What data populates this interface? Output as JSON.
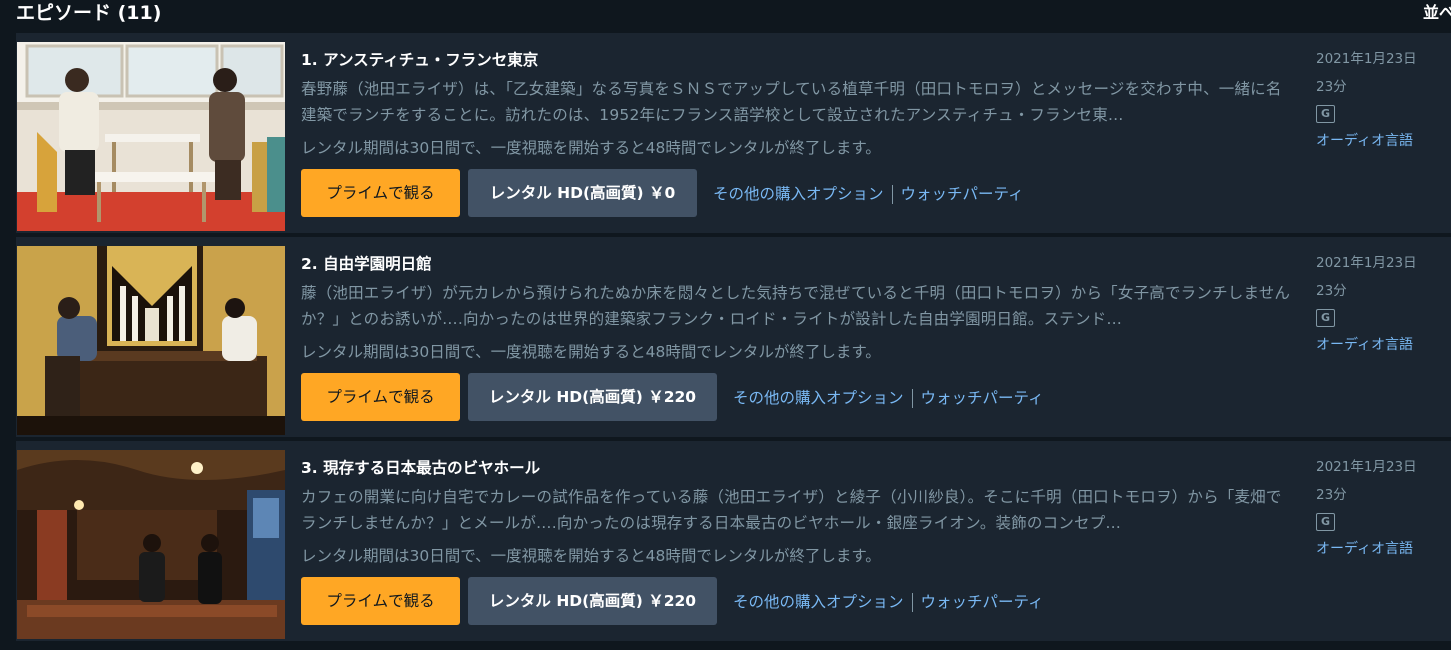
{
  "header": {
    "title": "エピソード (11)",
    "sort_label": "並べ替え"
  },
  "episodes": [
    {
      "title": "1. アンスティチュ・フランセ東京",
      "synopsis": "春野藤（池田エライザ）は、「乙女建築」なる写真をＳＮＳでアップしている植草千明（田口トモロヲ）とメッセージを交わす中、一緒に名建築でランチをすることに。訪れたのは、1952年にフランス語学校として設立されたアンスティチュ・フランセ東…",
      "rental_note": "レンタル期間は30日間で、一度視聴を開始すると48時間でレンタルが終了します。",
      "prime_button": "プライムで観る",
      "rent_button": "レンタル HD(高画質) ￥0",
      "other_options": "その他の購入オプション",
      "watch_party": "ウォッチパーティ",
      "date": "2021年1月23日",
      "runtime": "23分",
      "rating": "G",
      "audio": "オーディオ言語",
      "thumbnail_icon": "cafe-scene-thumbnail"
    },
    {
      "title": "2. 自由学園明日館",
      "synopsis": "藤（池田エライザ）が元カレから預けられたぬか床を悶々とした気持ちで混ぜていると千明（田口トモロヲ）から「女子高でランチしませんか？」とのお誘いが….向かったのは世界的建築家フランク・ロイド・ライトが設計した自由学園明日館。ステンド…",
      "rental_note": "レンタル期間は30日間で、一度視聴を開始すると48時間でレンタルが終了します。",
      "prime_button": "プライムで観る",
      "rent_button": "レンタル HD(高画質) ￥220",
      "other_options": "その他の購入オプション",
      "watch_party": "ウォッチパーティ",
      "date": "2021年1月23日",
      "runtime": "23分",
      "rating": "G",
      "audio": "オーディオ言語",
      "thumbnail_icon": "dining-hall-thumbnail"
    },
    {
      "title": "3. 現存する日本最古のビヤホール",
      "synopsis": "カフェの開業に向け自宅でカレーの試作品を作っている藤（池田エライザ）と綾子（小川紗良）。そこに千明（田口トモロヲ）から「麦畑でランチしませんか？」とメールが….向かったのは現存する日本最古のビヤホール・銀座ライオン。装飾のコンセプ…",
      "rental_note": "レンタル期間は30日間で、一度視聴を開始すると48時間でレンタルが終了します。",
      "prime_button": "プライムで観る",
      "rent_button": "レンタル HD(高画質) ￥220",
      "other_options": "その他の購入オプション",
      "watch_party": "ウォッチパーティ",
      "date": "2021年1月23日",
      "runtime": "23分",
      "rating": "G",
      "audio": "オーディオ言語",
      "thumbnail_icon": "beer-hall-thumbnail"
    }
  ],
  "colors": {
    "background": "#0f171e",
    "card": "#1b2530",
    "prime_button": "#ffa724",
    "rent_button": "#425265",
    "link": "#79b8f3",
    "muted_text": "#8197a4"
  }
}
